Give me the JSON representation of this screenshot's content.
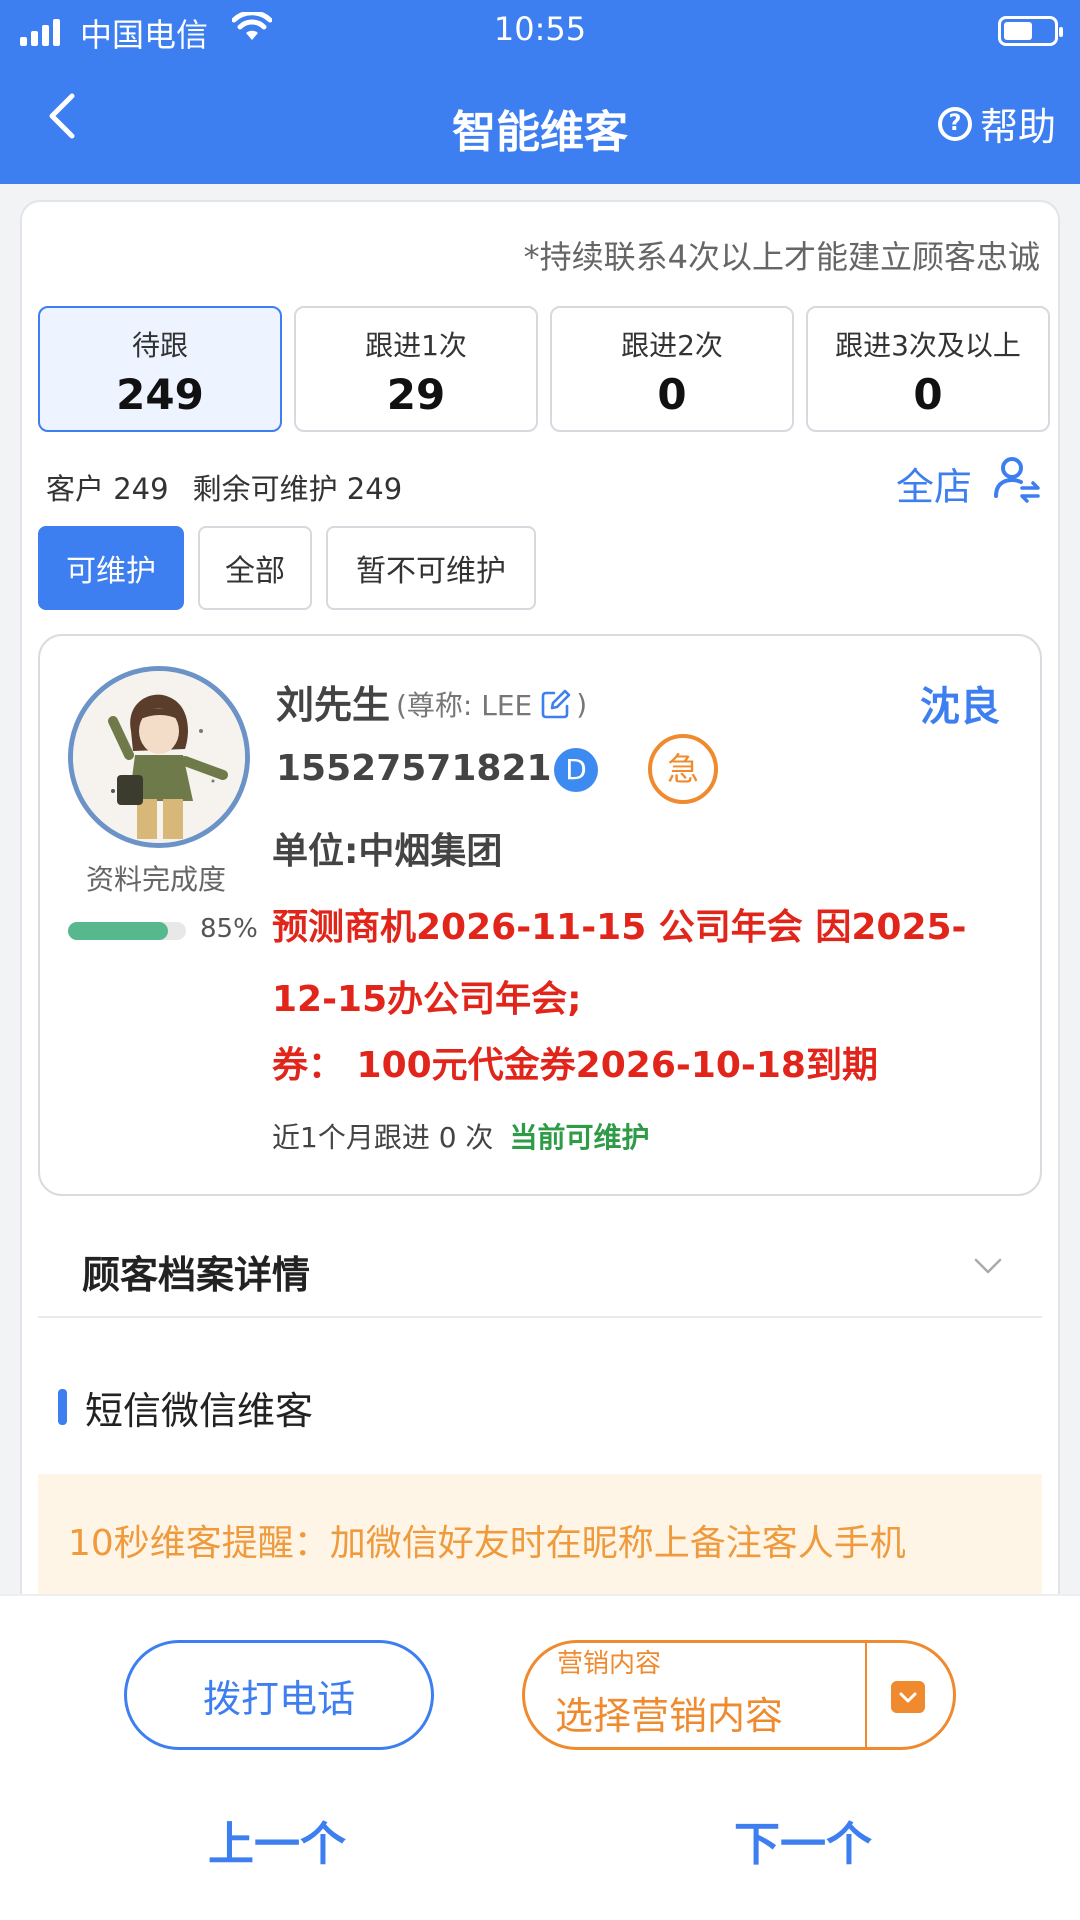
{
  "status_bar": {
    "carrier": "中国电信",
    "time": "10:55"
  },
  "header": {
    "title": "智能维客",
    "help_label": "帮助",
    "help_glyph": "?"
  },
  "tip": "*持续联系4次以上才能建立顾客忠诚",
  "stats": [
    {
      "label": "待跟",
      "value": "249"
    },
    {
      "label": "跟进1次",
      "value": "29"
    },
    {
      "label": "跟进2次",
      "value": "0"
    },
    {
      "label": "跟进3次及以上",
      "value": "0"
    }
  ],
  "summary": {
    "customers": "客户 249",
    "remaining": "剩余可维护 249",
    "store_label": "全店"
  },
  "filters": [
    {
      "label": "可维护"
    },
    {
      "label": "全部"
    },
    {
      "label": "暂不可维护"
    }
  ],
  "customer": {
    "name": "刘先生",
    "nickname_prefix": "(尊称: LEE",
    "nickname_suffix": ")",
    "owner": "沈良",
    "phone": "15527571821",
    "d_badge": "D",
    "urgent_badge": "急",
    "completion_label": "资料完成度",
    "completion_text": "85%",
    "completion_value": 0.85,
    "company": "单位:中烟集团",
    "opportunity": "预测商机2026-11-15 公司年会 因2025-12-15办公司年会;",
    "coupon": "券：  100元代金券2026-10-18到期",
    "follow_text": "近1个月跟进 0 次",
    "follow_status": "当前可维护"
  },
  "archive": {
    "title": "顾客档案详情"
  },
  "sms": {
    "title": "短信微信维客"
  },
  "reminder": "10秒维客提醒：加微信好友时在昵称上备注客人手机",
  "bottom": {
    "call_label": "拨打电话",
    "marketing_caption": "营销内容",
    "marketing_placeholder": "选择营销内容",
    "prev_label": "上一个",
    "next_label": "下一个"
  },
  "colors": {
    "primary": "#3d7ef0",
    "accent": "#ef8a2e",
    "alert": "#e1251b",
    "success": "#2e9b46"
  }
}
